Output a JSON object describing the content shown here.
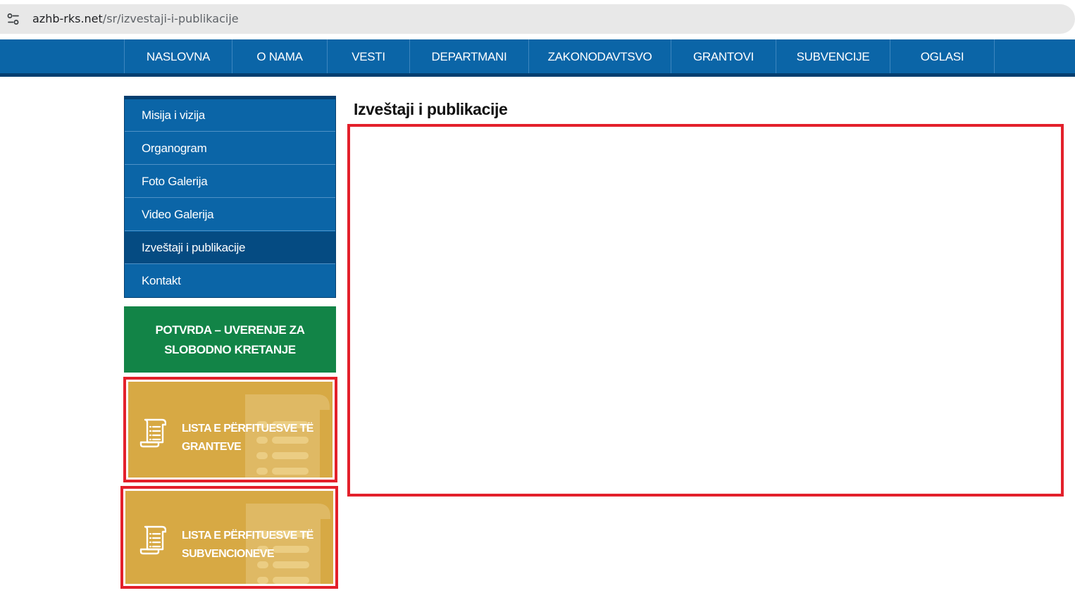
{
  "browser": {
    "url_host": "azhb-rks.net",
    "url_path": "/sr/izvestaji-i-publikacije",
    "site_info_icon": "tune-icon"
  },
  "topnav": {
    "items": [
      {
        "label": "NASLOVNA"
      },
      {
        "label": "O NAMA"
      },
      {
        "label": "VESTI"
      },
      {
        "label": "DEPARTMANI"
      },
      {
        "label": "ZAKONODAVTSVO"
      },
      {
        "label": "GRANTOVI"
      },
      {
        "label": "SUBVENCIJE"
      },
      {
        "label": "OGLASI"
      }
    ]
  },
  "sidebar": {
    "items": [
      {
        "label": "Misija i vizija"
      },
      {
        "label": "Organogram"
      },
      {
        "label": "Foto Galerija"
      },
      {
        "label": "Video Galerija"
      },
      {
        "label": "Izveštaji i publikacije",
        "active": true
      },
      {
        "label": "Kontakt"
      }
    ],
    "green_banner": {
      "line1": "POTVRDA – UVERENJE ZA",
      "line2": "SLOBODNO KRETANJE"
    },
    "gold_banners": [
      {
        "line1": "LISTA E PËRFITUESVE TË",
        "line2": "GRANTEVE",
        "icon": "scroll-list-icon"
      },
      {
        "line1": "LISTA E PËRFITUESVE TË",
        "line2": "SUBVENCIONEVE",
        "icon": "scroll-list-icon"
      }
    ]
  },
  "main": {
    "title": "Izveštaji i publikacije"
  },
  "colors": {
    "nav_blue": "#0b65a7",
    "nav_dark": "#043f70",
    "active_item": "#054b82",
    "green": "#128447",
    "gold": "#d7a944",
    "highlight_red": "#e3202b"
  }
}
